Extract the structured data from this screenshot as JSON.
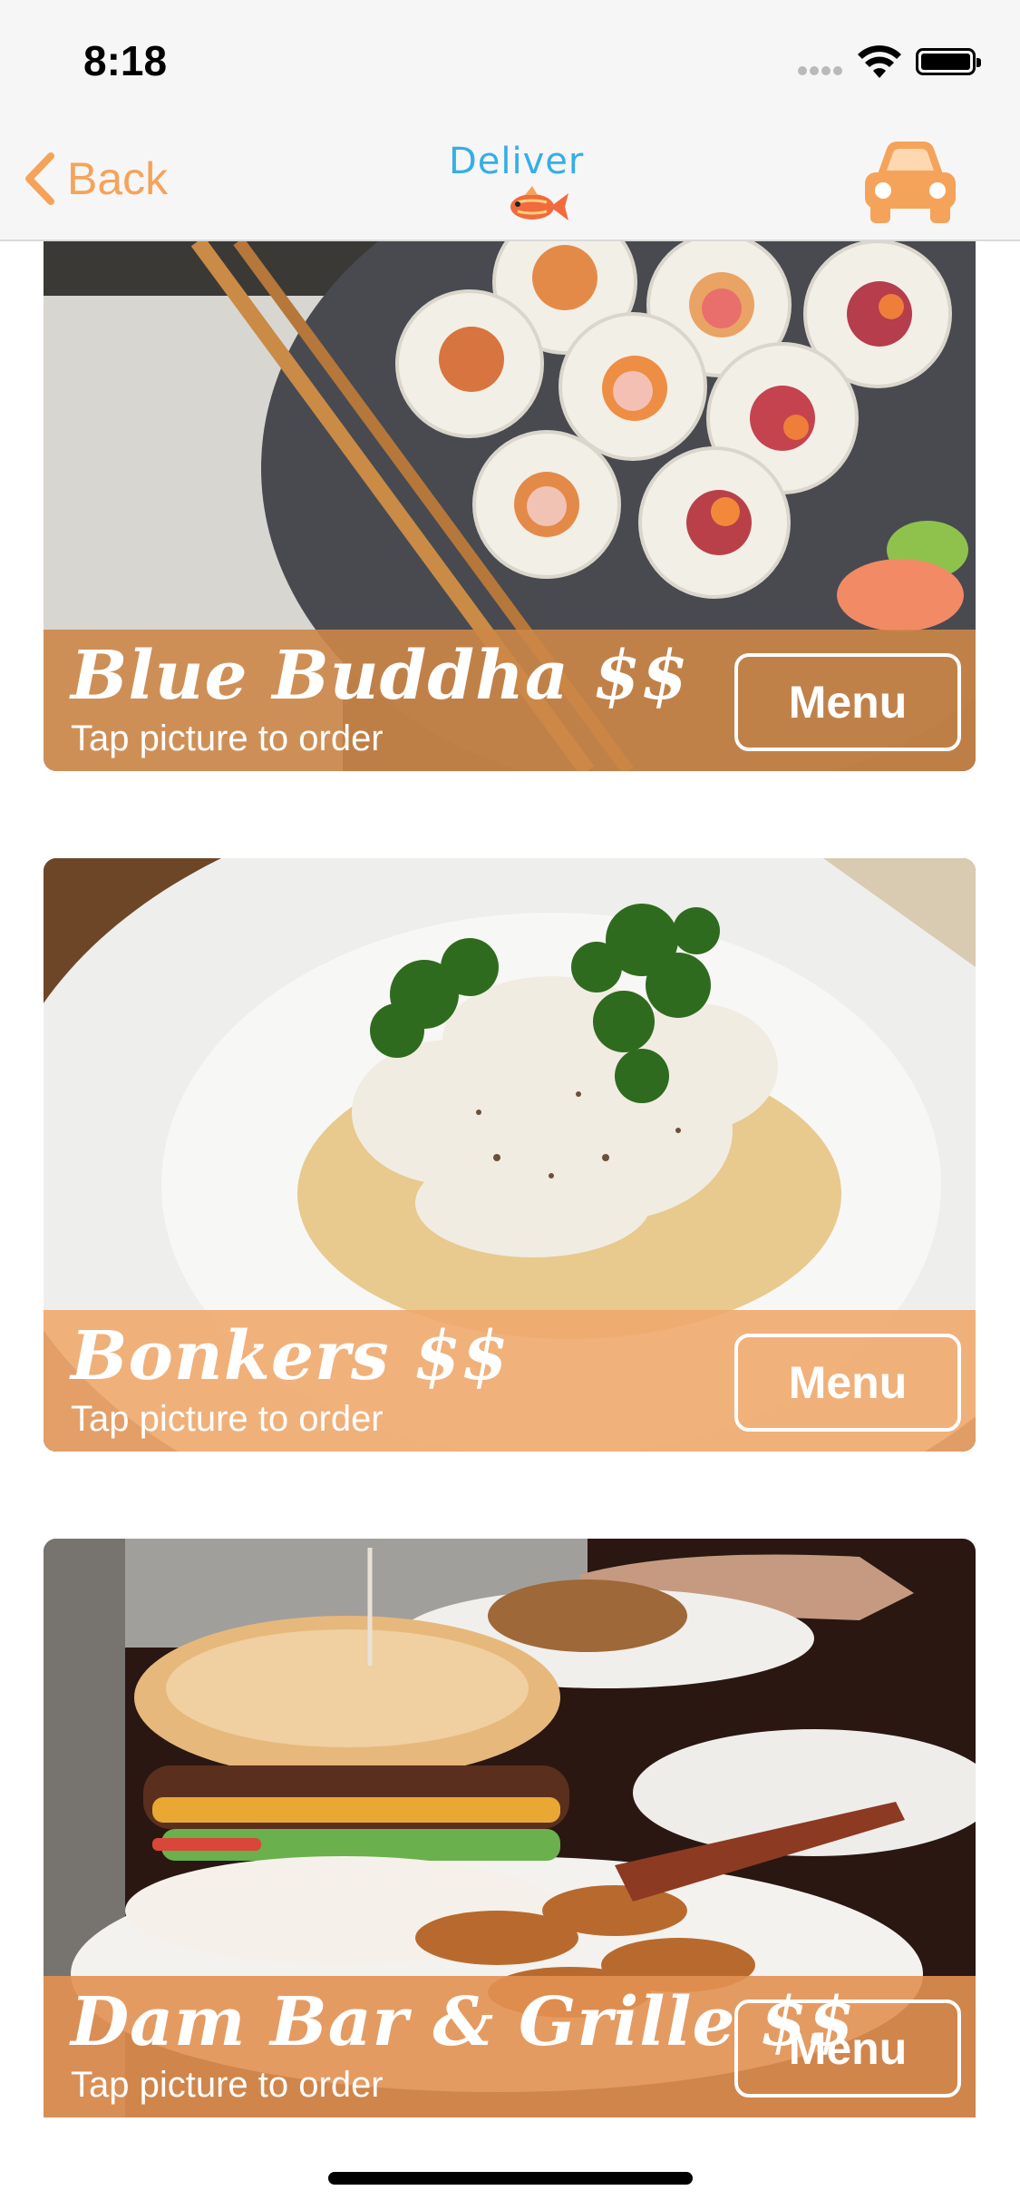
{
  "status_bar": {
    "time": "8:18"
  },
  "nav": {
    "back_label": "Back",
    "logo_text": "Deliver"
  },
  "colors": {
    "accent": "#f5a35a",
    "logo_blue": "#35aee6",
    "band_1": "#cd8748",
    "band_2": "#f0a86e",
    "band_3": "#e29152"
  },
  "restaurants": [
    {
      "name": "Blue Buddha $$",
      "subtitle": "Tap picture to order",
      "menu_label": "Menu",
      "photo": "sushi-rolls"
    },
    {
      "name": "Bonkers $$",
      "subtitle": "Tap picture to order",
      "menu_label": "Menu",
      "photo": "chicken-alfredo-pasta"
    },
    {
      "name": "Dam Bar & Grille $$",
      "subtitle": "Tap picture to order",
      "menu_label": "Menu",
      "photo": "burger-and-chips"
    }
  ]
}
